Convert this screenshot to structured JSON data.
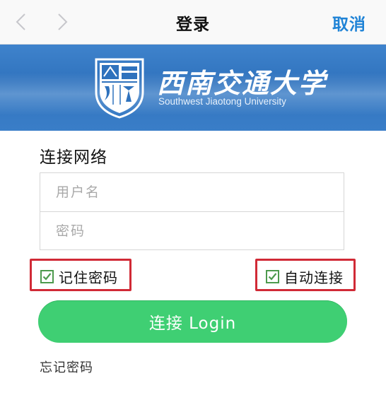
{
  "navbar": {
    "title": "登录",
    "cancel_label": "取消",
    "back_icon": "chevron-left-icon",
    "forward_icon": "chevron-right-icon"
  },
  "banner": {
    "university_name": "西南交通大学",
    "university_name_en": "Southwest Jiaotong University",
    "emblem_icon": "university-emblem-icon",
    "background_color": "#3578c4"
  },
  "form": {
    "section_title": "连接网络",
    "username_placeholder": "用户名",
    "username_value": "",
    "password_placeholder": "密码",
    "password_value": "",
    "remember_label": "记住密码",
    "remember_checked": true,
    "auto_connect_label": "自动连接",
    "auto_connect_checked": true,
    "login_button_label": "连接 Login",
    "login_button_color": "#3fcf73",
    "forgot_password_label": "忘记密码",
    "highlight_color": "#d12a36"
  }
}
